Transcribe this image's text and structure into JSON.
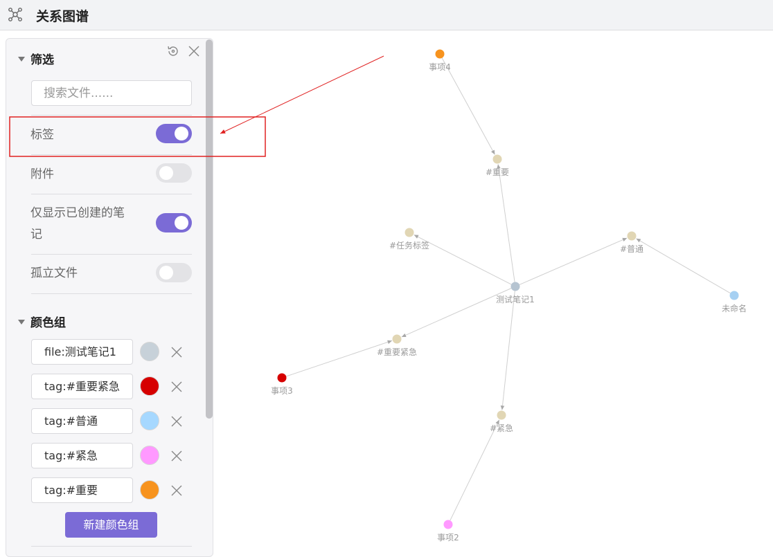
{
  "header": {
    "title": "关系图谱",
    "icon": "graph-network-icon"
  },
  "panel": {
    "filter": {
      "heading": "筛选",
      "search_placeholder": "搜索文件......",
      "options": [
        {
          "label": "标签",
          "enabled": true
        },
        {
          "label": "附件",
          "enabled": false
        },
        {
          "label": "仅显示已创建的笔记",
          "enabled": true
        },
        {
          "label": "孤立文件",
          "enabled": false
        }
      ]
    },
    "color_groups": {
      "heading": "颜色组",
      "groups": [
        {
          "query": "file:测试笔记1",
          "color": "#c7d1d9"
        },
        {
          "query": "tag:#重要紧急",
          "color": "#d60000"
        },
        {
          "query": "tag:#普通",
          "color": "#a6d8ff"
        },
        {
          "query": "tag:#紧急",
          "color": "#ff99ff"
        },
        {
          "query": "tag:#重要",
          "color": "#f7931e"
        }
      ],
      "new_button": "新建颜色组"
    },
    "controls": {
      "restore": "restore-icon",
      "close": "close-icon"
    }
  },
  "graph": {
    "edge_color": "#cfcfcf",
    "nodes": [
      {
        "id": "n4",
        "label": "事项4",
        "color": "#f7931e"
      },
      {
        "id": "zy",
        "label": "#重要",
        "color": "#e1d6b4"
      },
      {
        "id": "rw",
        "label": "#任务标签",
        "color": "#e1d6b4"
      },
      {
        "id": "pt",
        "label": "#普通",
        "color": "#e1d6b4"
      },
      {
        "id": "c1",
        "label": "测试笔记1",
        "color": "#b6c4d1"
      },
      {
        "id": "wm",
        "label": "未命名",
        "color": "#a6d0f2"
      },
      {
        "id": "zj",
        "label": "#重要紧急",
        "color": "#e1d6b4"
      },
      {
        "id": "n3",
        "label": "事项3",
        "color": "#d60000"
      },
      {
        "id": "jj",
        "label": "#紧急",
        "color": "#e1d6b4"
      },
      {
        "id": "n2",
        "label": "事项2",
        "color": "#ff99ff"
      }
    ]
  },
  "annotation": {
    "color": "#e02020"
  }
}
